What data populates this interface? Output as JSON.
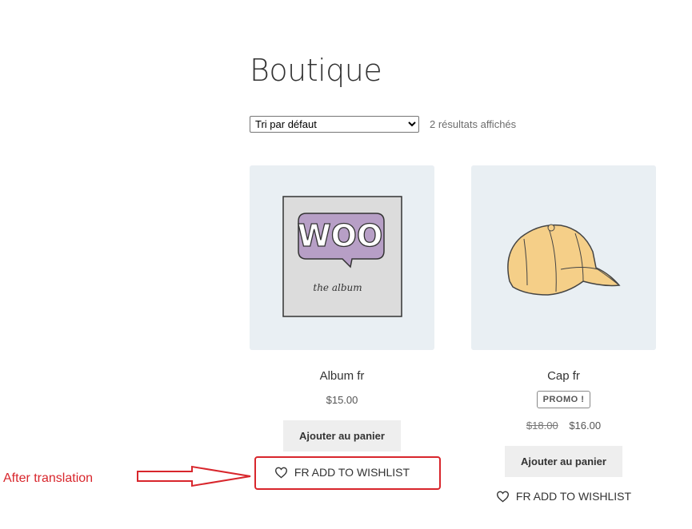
{
  "page": {
    "title": "Boutique"
  },
  "toolbar": {
    "sort_selected": "Tri par défaut",
    "result_count": "2 résultats affichés"
  },
  "products": [
    {
      "title": "Album fr",
      "price": "$15.00",
      "add_to_cart_label": "Ajouter au panier",
      "wishlist_label": "FR ADD TO WISHLIST",
      "image": "woo-album-icon",
      "image_text": {
        "logo": "WOO",
        "caption": "the album"
      }
    },
    {
      "title": "Cap fr",
      "badge": "PROMO !",
      "old_price": "$18.00",
      "price": "$16.00",
      "add_to_cart_label": "Ajouter au panier",
      "wishlist_label": "FR ADD TO WISHLIST",
      "image": "cap-icon"
    }
  ],
  "annotation": {
    "text": "After translation",
    "color": "#d8262c"
  },
  "colors": {
    "thumb_bg": "#e9eff3",
    "button_bg": "#eeeeee",
    "annotation_red": "#d8262c"
  }
}
